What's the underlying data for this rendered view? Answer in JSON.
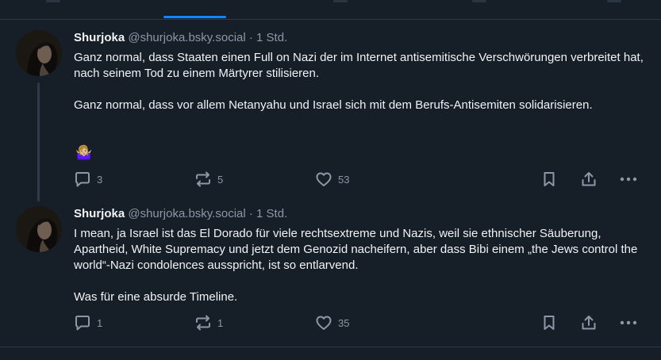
{
  "posts": [
    {
      "author": "Shurjoka",
      "handle": "@shurjoka.bsky.social",
      "separator": "·",
      "time": "1 Std.",
      "paragraphs": [
        "Ganz normal, dass Staaten einen Full on Nazi der im Internet antisemitische Verschwörungen verbreitet hat, nach seinem Tod zu einem Märtyrer stilisieren.",
        "Ganz normal, dass vor allem Netanyahu und Israel sich mit dem Berufs-Antisemiten solidarisieren."
      ],
      "emoji": "🤷🏼‍♀️",
      "replies": "3",
      "reposts": "5",
      "likes": "53"
    },
    {
      "author": "Shurjoka",
      "handle": "@shurjoka.bsky.social",
      "separator": "·",
      "time": "1 Std.",
      "paragraphs": [
        "I mean, ja Israel ist das El Dorado für viele rechtsextreme und Nazis, weil sie ethnischer Säuberung, Apartheid, White Supremacy und jetzt dem Genozid nacheifern, aber dass Bibi einem „the Jews control the world“-Nazi condolences ausspricht, ist so entlarvend.",
        "Was für eine absurde Timeline."
      ],
      "replies": "1",
      "reposts": "1",
      "likes": "35"
    }
  ],
  "icons": {
    "reply": "reply-icon",
    "repost": "repost-icon",
    "like": "heart-icon",
    "bookmark": "bookmark-icon",
    "share": "share-icon",
    "more": "more-icon"
  },
  "colors": {
    "background": "#161e27",
    "accent": "#1185fe",
    "text": "#f1f3f5",
    "muted": "#8b98a7",
    "divider": "#2e3a48"
  }
}
